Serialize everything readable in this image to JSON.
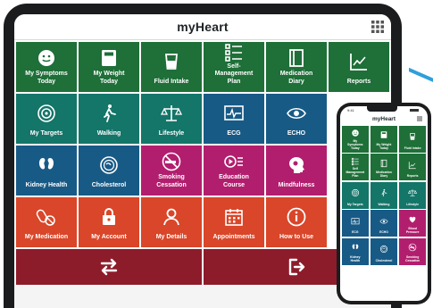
{
  "app": {
    "title": "myHeart",
    "menu_icon": "grid-menu-icon"
  },
  "colors": {
    "green": "#1e6f38",
    "teal": "#147569",
    "blue": "#185a86",
    "magenta": "#b21e6e",
    "orange": "#d94629",
    "maroon": "#8d1c2b",
    "connector": "#2e9fdc"
  },
  "tablet": {
    "tiles": [
      {
        "label": "My Symptoms\nToday",
        "icon": "smiley-face-icon",
        "color": "green"
      },
      {
        "label": "My Weight\nToday",
        "icon": "scale-icon",
        "color": "green"
      },
      {
        "label": "Fluid Intake",
        "icon": "water-glass-icon",
        "color": "green"
      },
      {
        "label": "Self-\nManagement\nPlan",
        "icon": "checklist-icon",
        "color": "green"
      },
      {
        "label": "Medication\nDiary",
        "icon": "book-icon",
        "color": "green"
      },
      {
        "label": "Reports",
        "icon": "line-chart-icon",
        "color": "green"
      },
      {
        "label": "My Targets",
        "icon": "target-icon",
        "color": "teal"
      },
      {
        "label": "Walking",
        "icon": "walking-icon",
        "color": "teal"
      },
      {
        "label": "Lifestyle",
        "icon": "balance-scale-icon",
        "color": "teal"
      },
      {
        "label": "ECG",
        "icon": "ecg-monitor-icon",
        "color": "blue"
      },
      {
        "label": "ECHO",
        "icon": "echo-eye-icon",
        "color": "blue"
      },
      {
        "label": "",
        "icon": "",
        "color": "white"
      },
      {
        "label": "Kidney Health",
        "icon": "kidneys-icon",
        "color": "blue"
      },
      {
        "label": "Cholesterol",
        "icon": "cholesterol-icon",
        "color": "blue"
      },
      {
        "label": "Smoking\nCessation",
        "icon": "no-smoking-icon",
        "color": "magenta"
      },
      {
        "label": "Education\nCourse",
        "icon": "play-list-icon",
        "color": "magenta"
      },
      {
        "label": "Mindfulness",
        "icon": "head-icon",
        "color": "magenta"
      },
      {
        "label": "",
        "icon": "",
        "color": "white"
      },
      {
        "label": "My Medication",
        "icon": "pills-icon",
        "color": "orange"
      },
      {
        "label": "My Account",
        "icon": "lock-icon",
        "color": "orange"
      },
      {
        "label": "My Details",
        "icon": "person-icon",
        "color": "orange"
      },
      {
        "label": "Appointments",
        "icon": "calendar-icon",
        "color": "orange"
      },
      {
        "label": "How to Use",
        "icon": "info-icon",
        "color": "orange"
      },
      {
        "label": "",
        "icon": "",
        "color": "white"
      }
    ],
    "bottom": [
      {
        "icon": "swap-arrows-icon"
      },
      {
        "icon": "logout-icon"
      }
    ]
  },
  "phone": {
    "time": "9:41",
    "title": "myHeart",
    "tiles": [
      {
        "label": "My\nSymptoms\nToday",
        "icon": "smiley-face-icon",
        "color": "green"
      },
      {
        "label": "My Weight\nToday",
        "icon": "scale-icon",
        "color": "green"
      },
      {
        "label": "Fluid Intake",
        "icon": "water-glass-icon",
        "color": "green"
      },
      {
        "label": "Self\nManagement\nPlan",
        "icon": "checklist-icon",
        "color": "green"
      },
      {
        "label": "Medication\nDiary",
        "icon": "book-icon",
        "color": "green"
      },
      {
        "label": "Reports",
        "icon": "line-chart-icon",
        "color": "green"
      },
      {
        "label": "My Targets",
        "icon": "target-icon",
        "color": "teal"
      },
      {
        "label": "Walking",
        "icon": "walking-icon",
        "color": "teal"
      },
      {
        "label": "Lifestyle",
        "icon": "balance-scale-icon",
        "color": "teal"
      },
      {
        "label": "ECG",
        "icon": "ecg-monitor-icon",
        "color": "blue"
      },
      {
        "label": "ECHO",
        "icon": "echo-eye-icon",
        "color": "blue"
      },
      {
        "label": "Blood\nPressure",
        "icon": "heart-icon",
        "color": "magenta"
      },
      {
        "label": "Kidney\nHealth",
        "icon": "kidneys-icon",
        "color": "blue"
      },
      {
        "label": "Cholesterol",
        "icon": "cholesterol-icon",
        "color": "blue"
      },
      {
        "label": "Smoking\nCessation",
        "icon": "no-smoking-icon",
        "color": "magenta"
      }
    ]
  }
}
